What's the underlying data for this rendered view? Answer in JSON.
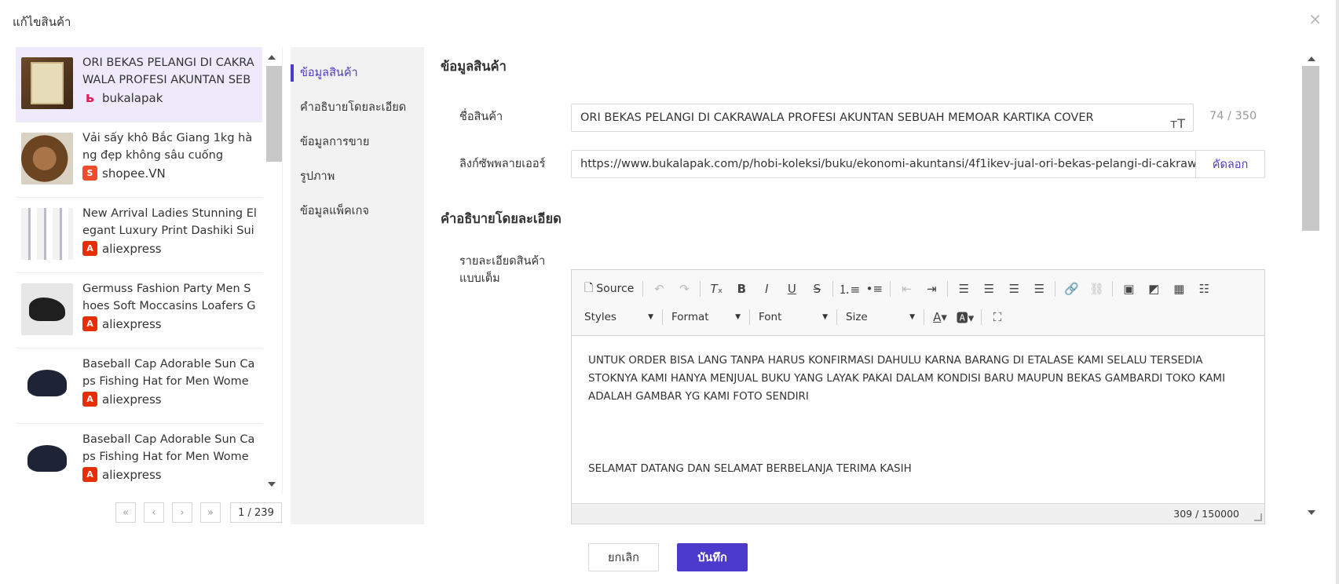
{
  "modal": {
    "title": "แก้ไขสินค้า",
    "close_icon": "×"
  },
  "products": [
    {
      "title": "ORI BEKAS PELANGI DI CAKRAWALA PROFESI AKUNTAN SEBUAH MEMOAR KARTIKA COVER",
      "platform": "bukalapak",
      "platform_icon": "bukalapak-icon"
    },
    {
      "title": "Vải sấy khô Bắc Giang 1kg hàng đẹp không sâu cuống",
      "platform": "shopee.VN",
      "platform_icon": "shopee-icon"
    },
    {
      "title": "New Arrival Ladies Stunning Elegant Luxury Print Dashiki Suit ...",
      "platform": "aliexpress",
      "platform_icon": "aliexpress-icon"
    },
    {
      "title": "Germuss Fashion Party Men Shoes Soft Moccasins Loafers Ge...",
      "platform": "aliexpress",
      "platform_icon": "aliexpress-icon"
    },
    {
      "title": "Baseball Cap Adorable Sun Caps Fishing Hat for Men Women...",
      "platform": "aliexpress",
      "platform_icon": "aliexpress-icon"
    },
    {
      "title": "Baseball Cap Adorable Sun Caps Fishing Hat for Men Women...",
      "platform": "aliexpress",
      "platform_icon": "aliexpress-icon"
    }
  ],
  "pager": {
    "first": "«",
    "prev": "‹",
    "next": "›",
    "last": "»",
    "count": "1 / 239"
  },
  "sections": [
    "ข้อมูลสินค้า",
    "คำอธิบายโดยละเอียด",
    "ข้อมูลการขาย",
    "รูปภาพ",
    "ข้อมูลแพ็คเกจ"
  ],
  "product_info": {
    "heading": "ข้อมูลสินค้า",
    "name_label": "ชื่อสินค้า",
    "name_value": "ORI BEKAS PELANGI DI CAKRAWALA PROFESI AKUNTAN SEBUAH MEMOAR KARTIKA COVER",
    "name_count": "74 / 350",
    "supplier_label": "ลิงก์ซัพพลายเออร์",
    "supplier_url": "https://www.bukalapak.com/p/hobi-koleksi/buku/ekonomi-akuntansi/4f1ikev-jual-ori-bekas-pelangi-di-cakraw",
    "copy_label": "คัดลอก"
  },
  "description": {
    "heading": "คำอธิบายโดยละเอียด",
    "label": "รายละเอียดสินค้าแบบเต็ม",
    "toolbar": {
      "source": "Source",
      "styles": "Styles",
      "format": "Format",
      "font": "Font",
      "size": "Size"
    },
    "paragraph1": "UNTUK ORDER BISA LANG TANPA HARUS KONFIRMASI DAHULU KARNA BARANG DI ETALASE KAMI SELALU TERSEDIA STOKNYA KAMI HANYA MENJUAL BUKU YANG LAYAK PAKAI DALAM KONDISI BARU MAUPUN BEKAS GAMBARDI TOKO KAMI ADALAH GAMBAR YG KAMI FOTO SENDIRI",
    "paragraph2": "SELAMAT DATANG DAN SELAMAT BERBELANJA TERIMA KASIH",
    "char_count": "309 / 150000"
  },
  "actions": {
    "cancel": "ยกเลิก",
    "save": "บันทึก"
  },
  "colors": {
    "accent": "#4b3acb",
    "active_bg": "#eeeafc"
  }
}
